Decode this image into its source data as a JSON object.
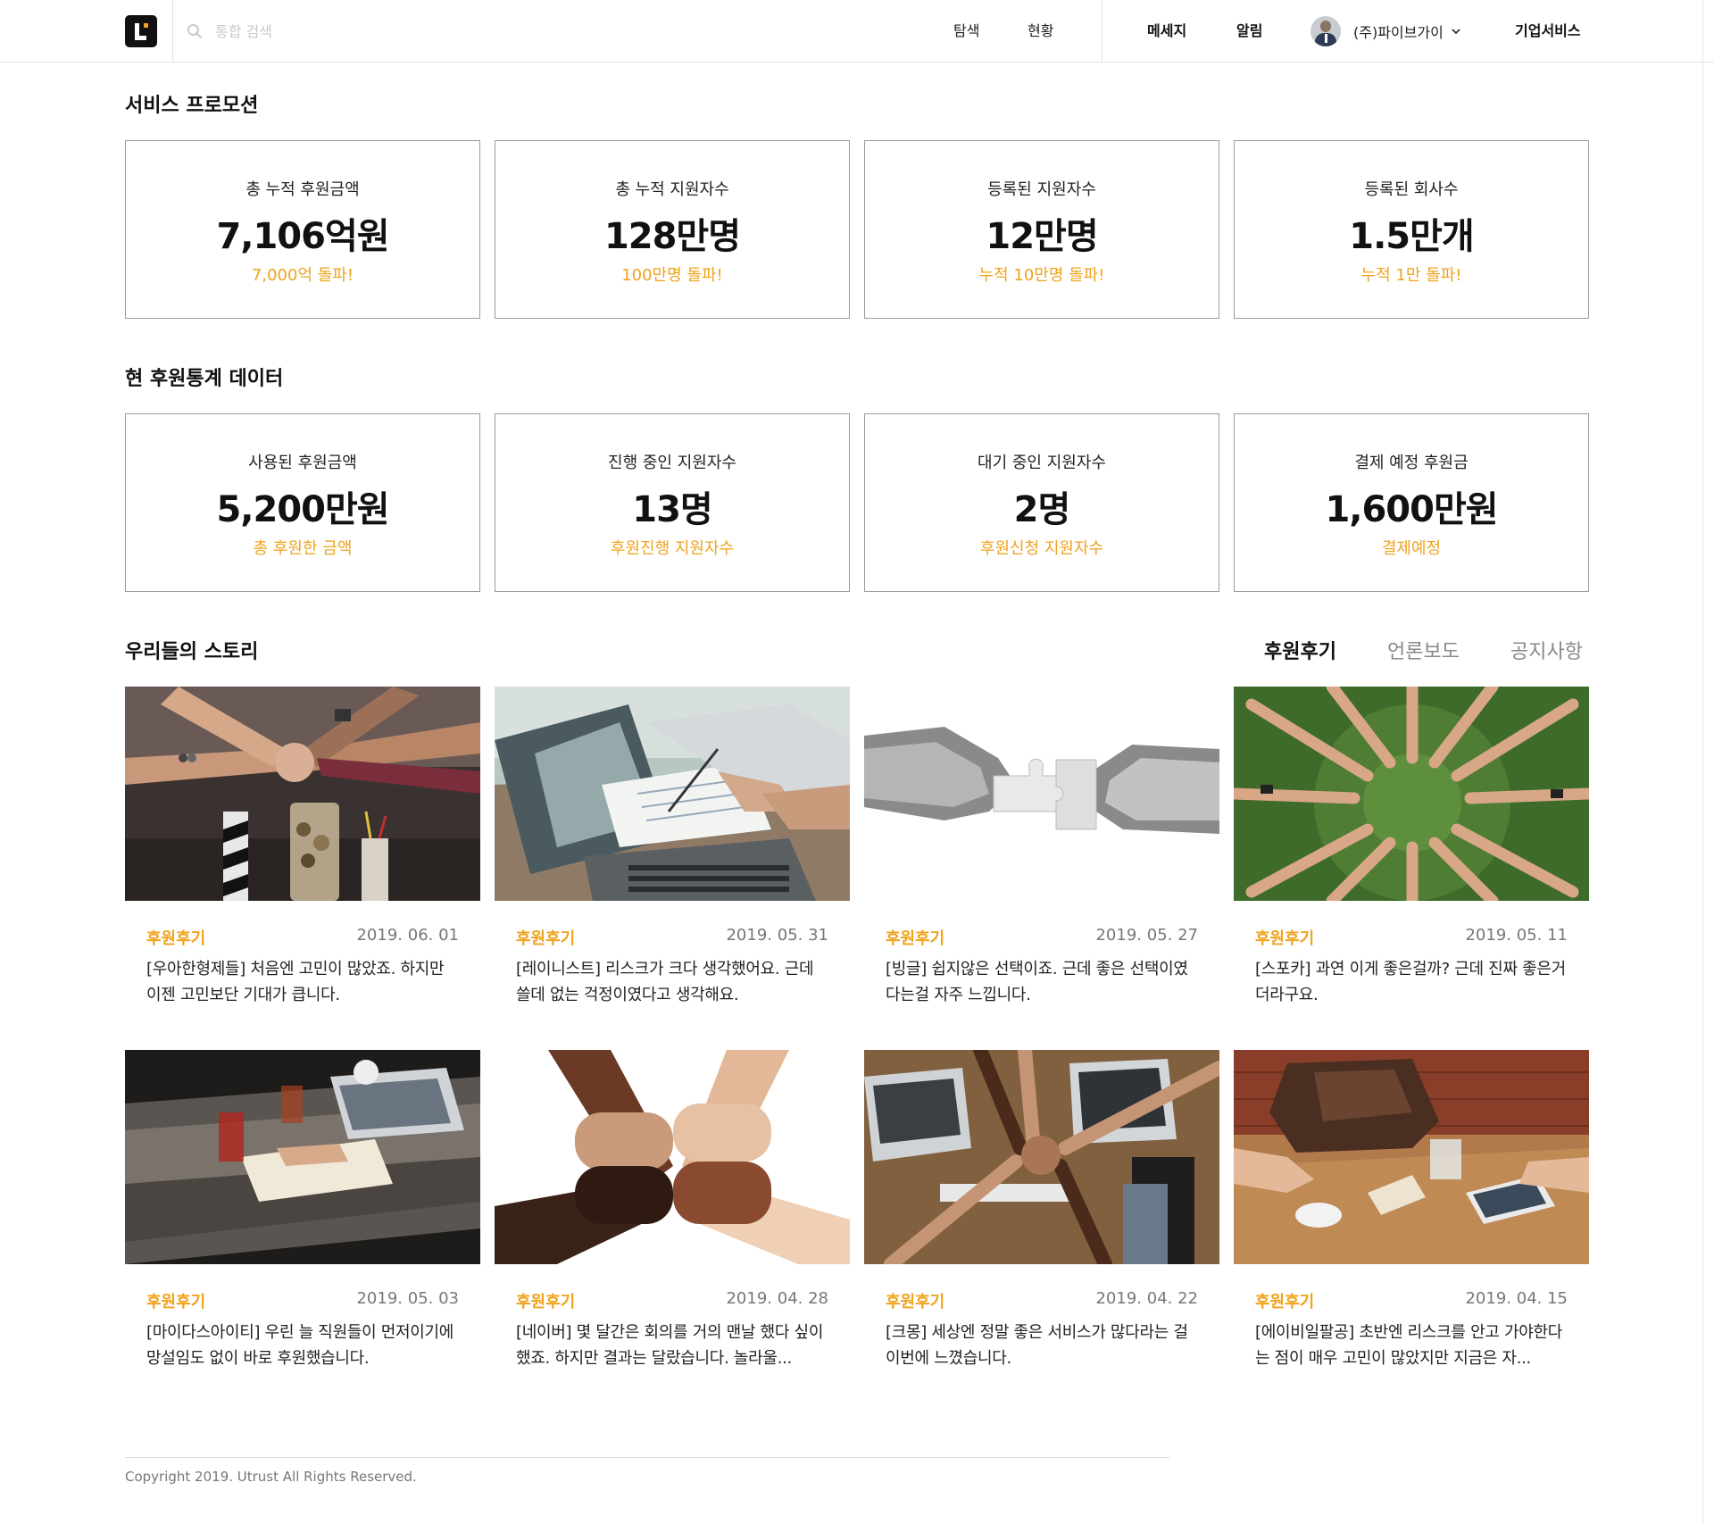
{
  "header": {
    "search_placeholder": "통합 검색",
    "nav": [
      "탐색",
      "현황"
    ],
    "messages": "메세지",
    "alerts": "알림",
    "company_name": "(주)파이브가이",
    "enterprise": "기업서비스"
  },
  "promo": {
    "title": "서비스 프로모션",
    "cards": [
      {
        "label": "총 누적 후원금액",
        "value": "7,106억원",
        "sub": "7,000억 돌파!"
      },
      {
        "label": "총 누적 지원자수",
        "value": "128만명",
        "sub": "100만명 돌파!"
      },
      {
        "label": "등록된 지원자수",
        "value": "12만명",
        "sub": "누적 10만명 돌파!"
      },
      {
        "label": "등록된 회사수",
        "value": "1.5만개",
        "sub": "누적 1만 돌파!"
      }
    ]
  },
  "stats": {
    "title": "현 후원통계 데이터",
    "cards": [
      {
        "label": "사용된 후원금액",
        "value": "5,200만원",
        "sub": "총 후원한 금액"
      },
      {
        "label": "진행 중인 지원자수",
        "value": "13명",
        "sub": "후원진행 지원자수"
      },
      {
        "label": "대기 중인 지원자수",
        "value": "2명",
        "sub": "후원신청 지원자수"
      },
      {
        "label": "결제 예정 후원금",
        "value": "1,600만원",
        "sub": "결제예정"
      }
    ]
  },
  "stories": {
    "title": "우리들의 스토리",
    "tabs": [
      "후원후기",
      "언론보도",
      "공지사항"
    ],
    "active_tab": "후원후기",
    "items": [
      {
        "tag": "후원후기",
        "date": "2019. 06. 01",
        "text": "[우아한형제들] 처음엔 고민이 많았죠. 하지만 이젠 고민보단 기대가 큽니다."
      },
      {
        "tag": "후원후기",
        "date": "2019. 05. 31",
        "text": "[레이니스트] 리스크가 크다 생각했어요. 근데 쓸데 없는 걱정이였다고 생각해요."
      },
      {
        "tag": "후원후기",
        "date": "2019. 05. 27",
        "text": "[빙글] 쉽지않은 선택이죠. 근데 좋은 선택이였다는걸 자주 느낍니다."
      },
      {
        "tag": "후원후기",
        "date": "2019. 05. 11",
        "text": "[스포카] 과연 이게 좋은걸까?  근데 진짜 좋은거더라구요."
      },
      {
        "tag": "후원후기",
        "date": "2019. 05. 03",
        "text": "[마이다스아이티] 우린 늘 직원들이 먼저이기에 망설임도 없이 바로 후원했습니다."
      },
      {
        "tag": "후원후기",
        "date": "2019. 04. 28",
        "text": "[네이버] 몇 달간은 회의를 거의 맨날 했다 싶이 했죠. 하지만 결과는 달랐습니다. 놀라울..."
      },
      {
        "tag": "후원후기",
        "date": "2019. 04. 22",
        "text": "[크몽] 세상엔 정말 좋은 서비스가 많다라는 걸 이번에 느꼈습니다."
      },
      {
        "tag": "후원후기",
        "date": "2019. 04. 15",
        "text": "[에이비일팔공] 초반엔 리스크를 안고 가야한다는 점이 매우 고민이 많았지만 지금은 자..."
      }
    ]
  },
  "footer": {
    "copyright": "Copyright 2019. Utrust All Rights Reserved."
  },
  "colors": {
    "accent": "#f0a31c",
    "border": "#9a9a9a"
  }
}
